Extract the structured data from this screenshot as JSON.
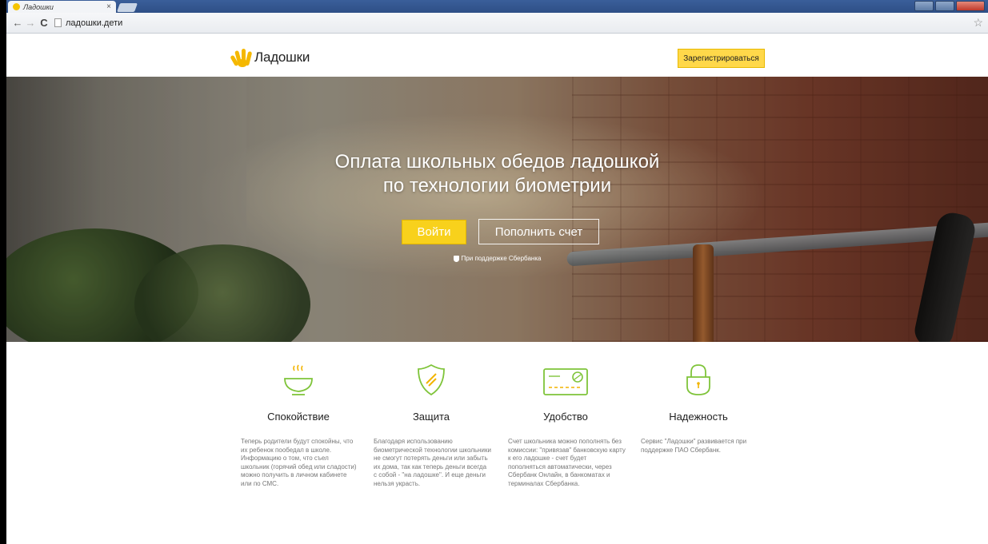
{
  "browser": {
    "tab_title": "Ладошки",
    "tab_close": "×",
    "url": "ладошки.дети",
    "back": "←",
    "forward": "→",
    "reload": "C",
    "bookmark": "☆"
  },
  "header": {
    "logo_text": "Ладошки",
    "register_label": "Зарегистрироваться"
  },
  "hero": {
    "title_line1": "Оплата школьных обедов ладошкой",
    "title_line2": "по технологии биометрии",
    "login_label": "Войти",
    "topup_label": "Пополнить счет",
    "support_text": "При поддержке Сбербанка"
  },
  "colors": {
    "accent": "#f8d11c",
    "icon_green": "#7fc43a"
  },
  "features": [
    {
      "icon": "soup-bowl-icon",
      "title": "Спокойствие",
      "text": "Теперь родители будут спокойны, что их ребенок пообедал в школе. Информацию о том, что съел школьник (горячий обед или сладости) можно получить в личном кабинете или по СМС."
    },
    {
      "icon": "shield-icon",
      "title": "Защита",
      "text": "Благодаря использованию биометрической технологии школьники не смогут потерять деньги или забыть их дома, так как теперь деньги всегда с собой - \"на ладошке\". И еще деньги нельзя украсть."
    },
    {
      "icon": "bank-card-icon",
      "title": "Удобство",
      "text": "Счет школьника можно пополнять без комиссии: \"привязав\" банковскую карту к его ладошке - счет будет пополняться автоматически, через Сбербанк Онлайн, в банкоматах и терминалах Сбербанка."
    },
    {
      "icon": "padlock-icon",
      "title": "Надежность",
      "text": "Сервис \"Ладошки\" развивается при поддержке ПАО Сбербанк."
    }
  ]
}
